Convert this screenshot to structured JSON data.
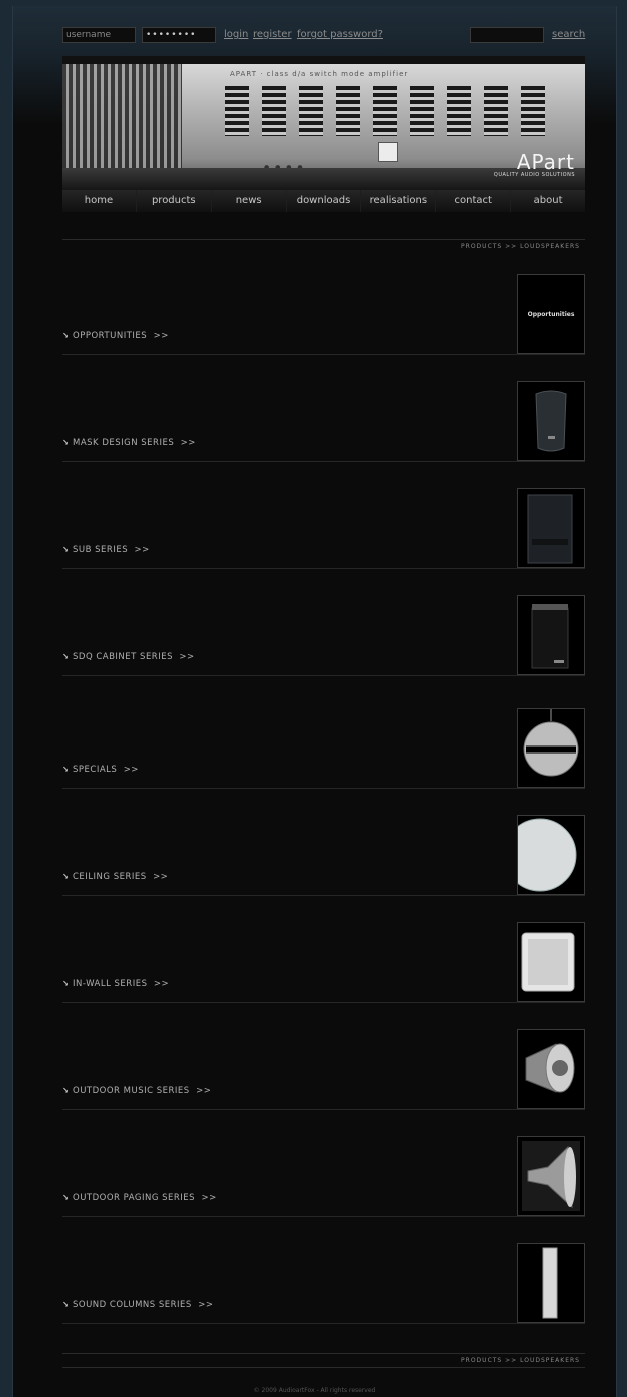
{
  "login": {
    "username_value": "username",
    "password_value": "••••••••",
    "login": "login",
    "register": "register",
    "forgot": "forgot password?",
    "search_value": "",
    "search": "search"
  },
  "banner": {
    "caption": "APART · class d/a switch mode amplifier",
    "logo": "APart",
    "logo_sub": "QUALITY AUDIO SOLUTIONS"
  },
  "nav": [
    "home",
    "products",
    "news",
    "downloads",
    "realisations",
    "contact",
    "about"
  ],
  "breadcrumb": "PRODUCTS >> LOUDSPEAKERS",
  "categories": [
    {
      "label": "OPPORTUNITIES",
      "more": ">>",
      "thumb": "Opportunities",
      "icon": "opportunities-thumb"
    },
    {
      "label": "MASK DESIGN SERIES",
      "more": ">>",
      "icon": "mask-speaker-thumb"
    },
    {
      "label": "SUB SERIES",
      "more": ">>",
      "icon": "subwoofer-thumb"
    },
    {
      "label": "SDQ CABINET SERIES",
      "more": ">>",
      "icon": "cabinet-speaker-thumb"
    },
    {
      "label": "SPECIALS",
      "more": ">>",
      "icon": "pendant-speaker-thumb"
    },
    {
      "label": "CEILING SERIES",
      "more": ">>",
      "icon": "ceiling-speaker-thumb"
    },
    {
      "label": "IN-WALL SERIES",
      "more": ">>",
      "icon": "inwall-speaker-thumb"
    },
    {
      "label": "OUTDOOR MUSIC SERIES",
      "more": ">>",
      "icon": "outdoor-speaker-thumb"
    },
    {
      "label": "OUTDOOR PAGING SERIES",
      "more": ">>",
      "icon": "horn-speaker-thumb"
    },
    {
      "label": "SOUND COLUMNS SERIES",
      "more": ">>",
      "icon": "column-speaker-thumb"
    }
  ],
  "footer": {
    "breadcrumb": "PRODUCTS >> LOUDSPEAKERS",
    "copyright": "© 2009 AudioartFox - All rights reserved"
  }
}
